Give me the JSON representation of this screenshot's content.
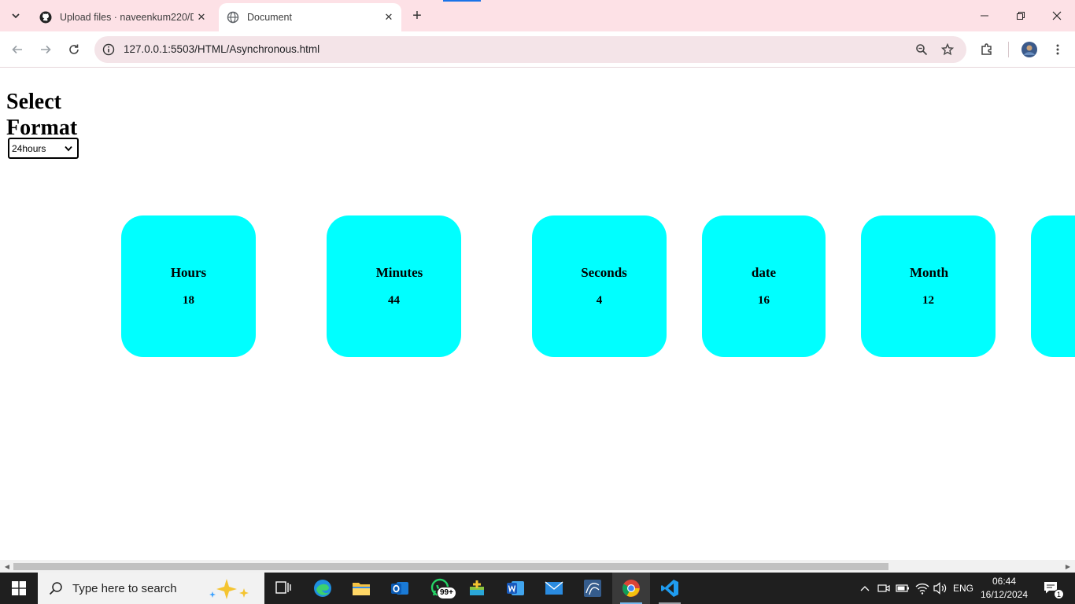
{
  "browser": {
    "tabs": [
      {
        "title": "Upload files · naveenkum220/D",
        "active": false
      },
      {
        "title": "Document",
        "active": true
      }
    ],
    "url": "127.0.0.1:5503/HTML/Asynchronous.html"
  },
  "page": {
    "heading": "Select Format",
    "format_select": {
      "value": "24hours"
    },
    "cards": [
      {
        "label": "Hours",
        "value": "18"
      },
      {
        "label": "Minutes",
        "value": "44"
      },
      {
        "label": "Seconds",
        "value": "4"
      },
      {
        "label": "date",
        "value": "16"
      },
      {
        "label": "Month",
        "value": "12"
      },
      {
        "label": "",
        "value": ""
      }
    ],
    "card_color": "#00ffff"
  },
  "taskbar": {
    "search_placeholder": "Type here to search",
    "whatsapp_badge": "99+",
    "language": "ENG",
    "time": "06:44",
    "date": "16/12/2024",
    "notification_count": "1"
  },
  "colors": {
    "tabstrip_bg": "#fde1e6",
    "omnibox_bg": "#f4e4e8",
    "taskbar_bg": "#1f1f1f"
  }
}
